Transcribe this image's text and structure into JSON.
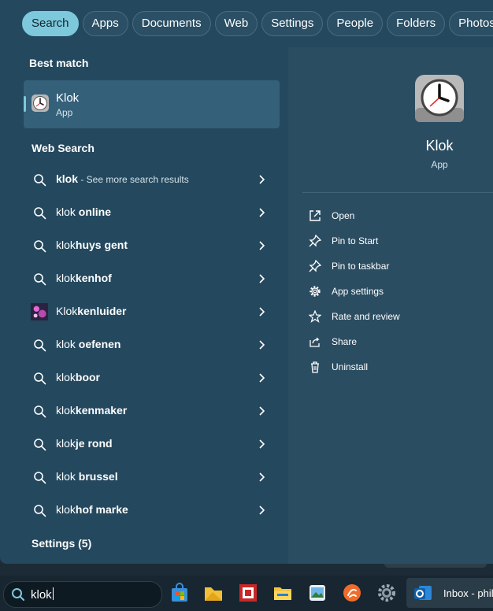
{
  "filters": [
    "Search",
    "Apps",
    "Documents",
    "Web",
    "Settings",
    "People",
    "Folders",
    "Photos"
  ],
  "active_filter": "Search",
  "best_match": {
    "heading": "Best match",
    "name": "Klok",
    "type": "App",
    "icon": "clock-icon"
  },
  "web_search": {
    "heading": "Web Search",
    "first": {
      "bold": "klok",
      "sub": " - See more search results"
    },
    "results": [
      {
        "normal": "klok",
        "bold": " online"
      },
      {
        "normal": "klok",
        "bold": "huys gent"
      },
      {
        "normal": "klok",
        "bold": "kenhof"
      },
      {
        "normal": "Klok",
        "bold": "kenluider",
        "thumbnail": true
      },
      {
        "normal": "klok",
        "bold": " oefenen"
      },
      {
        "normal": "klok",
        "bold": "boor"
      },
      {
        "normal": "klok",
        "bold": "kenmaker"
      },
      {
        "normal": "klok",
        "bold": "je rond"
      },
      {
        "normal": "klok",
        "bold": " brussel"
      },
      {
        "normal": "klok",
        "bold": "hof marke"
      }
    ]
  },
  "settings_heading": "Settings (5)",
  "detail": {
    "name": "Klok",
    "type": "App",
    "actions": [
      {
        "label": "Open",
        "icon": "open-external-icon"
      },
      {
        "label": "Pin to Start",
        "icon": "pin-icon"
      },
      {
        "label": "Pin to taskbar",
        "icon": "pin-icon"
      },
      {
        "label": "App settings",
        "icon": "gear-icon"
      },
      {
        "label": "Rate and review",
        "icon": "star-icon"
      },
      {
        "label": "Share",
        "icon": "share-icon"
      },
      {
        "label": "Uninstall",
        "icon": "trash-icon"
      }
    ]
  },
  "taskbar": {
    "search_value": "klok",
    "outlook_label": "Inbox - phil"
  },
  "colors": {
    "panel": "#24485e",
    "detail_panel": "#2b4d62",
    "accent": "#7ec8dc",
    "taskbar": "#172630"
  }
}
